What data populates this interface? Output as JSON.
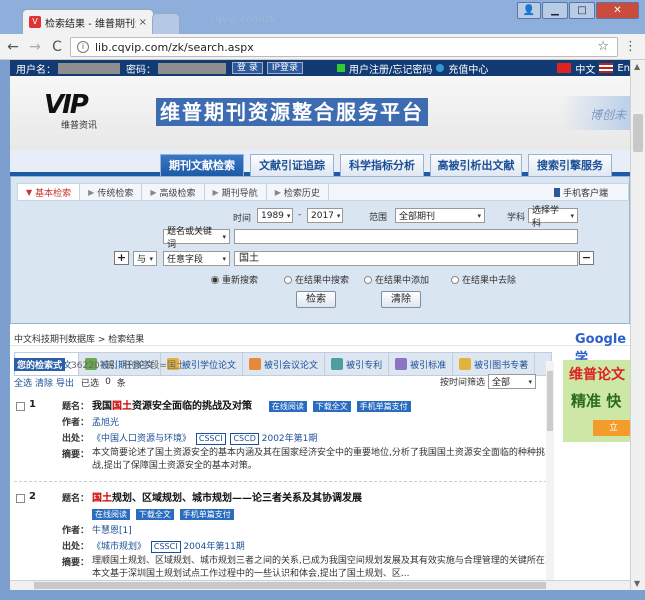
{
  "browser": {
    "tab_title": "检索结果 - 维普期刊资源",
    "tab_close": "×",
    "ghost_tab": "cqvip.com/zk",
    "url": "lib.cqvip.com/zk/search.aspx",
    "back": "←",
    "forward": "→",
    "reload": "C",
    "star": "☆",
    "menu": "⋮",
    "win_user": "👤",
    "win_min": "▁",
    "win_max": "□",
    "win_close": "✕"
  },
  "loginbar": {
    "username_label": "用户名：",
    "password_label": "密码：",
    "login_btn": "登 录",
    "ip_login_btn": "IP登录",
    "register_link": "用户注册/忘记密码",
    "recharge_link": "充值中心",
    "lang_cn": "中文",
    "lang_en": "En"
  },
  "header": {
    "logo_text": "VIP",
    "logo_sub": "维普资讯",
    "brand_title": "维普期刊资源整合服务平台",
    "brand_right": "博创未"
  },
  "main_nav": [
    {
      "label": "期刊文献检索"
    },
    {
      "label": "文献引证追踪"
    },
    {
      "label": "科学指标分析"
    },
    {
      "label": "高被引析出文献"
    },
    {
      "label": "搜索引擎服务"
    }
  ],
  "search_tabs": [
    {
      "label": "基本检索"
    },
    {
      "label": "传统检索"
    },
    {
      "label": "高级检索"
    },
    {
      "label": "期刊导航"
    },
    {
      "label": "检索历史"
    }
  ],
  "search": {
    "mobile_client": "手机客户端",
    "time_label": "时间",
    "year_from": "1989",
    "year_to": "2017",
    "dash": "-",
    "scope_label": "范围",
    "scope_value": "全部期刊",
    "subject_label": "学科",
    "subject_value": "选择学科",
    "field1": "题名或关键词",
    "plus": "+",
    "bool_op": "与",
    "field2": "任意字段",
    "query": "国土",
    "minus": "−",
    "radio_new": "重新搜索",
    "radio_within": "在结果中搜索",
    "radio_add": "在结果中添加",
    "radio_exclude": "在结果中去除",
    "search_btn": "检索",
    "clear_btn": "清除"
  },
  "breadcrumb": "中文科技期刊数据库 > 检索结果",
  "result_tabs": [
    {
      "label": "期刊全文"
    },
    {
      "label": "被引期刊论文"
    },
    {
      "label": "被引学位论文"
    },
    {
      "label": "被引会议论文"
    },
    {
      "label": "被引专利"
    },
    {
      "label": "被引标准"
    },
    {
      "label": "被引图书专著"
    }
  ],
  "stats": {
    "badge": "您的检索式",
    "count": "362207篇;",
    "expr": "任意字段=国土"
  },
  "controls": {
    "select_all": "全选",
    "clear": "清除",
    "export": "导出",
    "selected_label": "已选",
    "selected_count": "0",
    "unit": "条",
    "filter_label": "按时间筛选",
    "filter_value": "全部"
  },
  "records": [
    {
      "num": "1",
      "title_label": "题名：",
      "title_pre": "我国",
      "title_hl": "国土",
      "title_post": "资源安全面临的挑战及对策",
      "read_online": "在线阅读",
      "download": "下载全文",
      "buy": "手机单篇支付",
      "author_label": "作者：",
      "author": "孟旭光",
      "source_label": "出处：",
      "journal": "《中国人口资源与环境》",
      "tags": [
        "CSSCI",
        "CSCD"
      ],
      "issue": "2002年第1期",
      "abstract_label": "摘要：",
      "abstract": "本文简要论述了国土资源安全的基本内涵及其在国家经济安全中的重要地位,分析了我国国土资源安全面临的种种挑战,提出了保障国土资源安全的基本对策。"
    },
    {
      "num": "2",
      "title_label": "题名：",
      "title_pre": "",
      "title_hl": "国土",
      "title_post": "规划、区域规划、城市规划——论三者关系及其协调发展",
      "read_online": "在线阅读",
      "download": "下载全文",
      "buy": "手机单篇支付",
      "author_label": "作者：",
      "author": "牛慧恩[1]",
      "source_label": "出处：",
      "journal": "《城市规划》",
      "tags": [
        "CSSCI"
      ],
      "issue": "2004年第11期",
      "abstract_label": "摘要：",
      "abstract": "理顺国土规划、区域规划、城市规划三者之间的关系,已成为我国空间规划发展及其有效实施与合理管理的关键所在.本文基于深圳国土规划试点工作过程中的一些认识和体会,提出了国土规划、区..."
    }
  ],
  "sidebar": {
    "google": "Google 学",
    "ad_line1": "维普论文",
    "ad_line2": "精准 快",
    "ad_btn": "立"
  }
}
